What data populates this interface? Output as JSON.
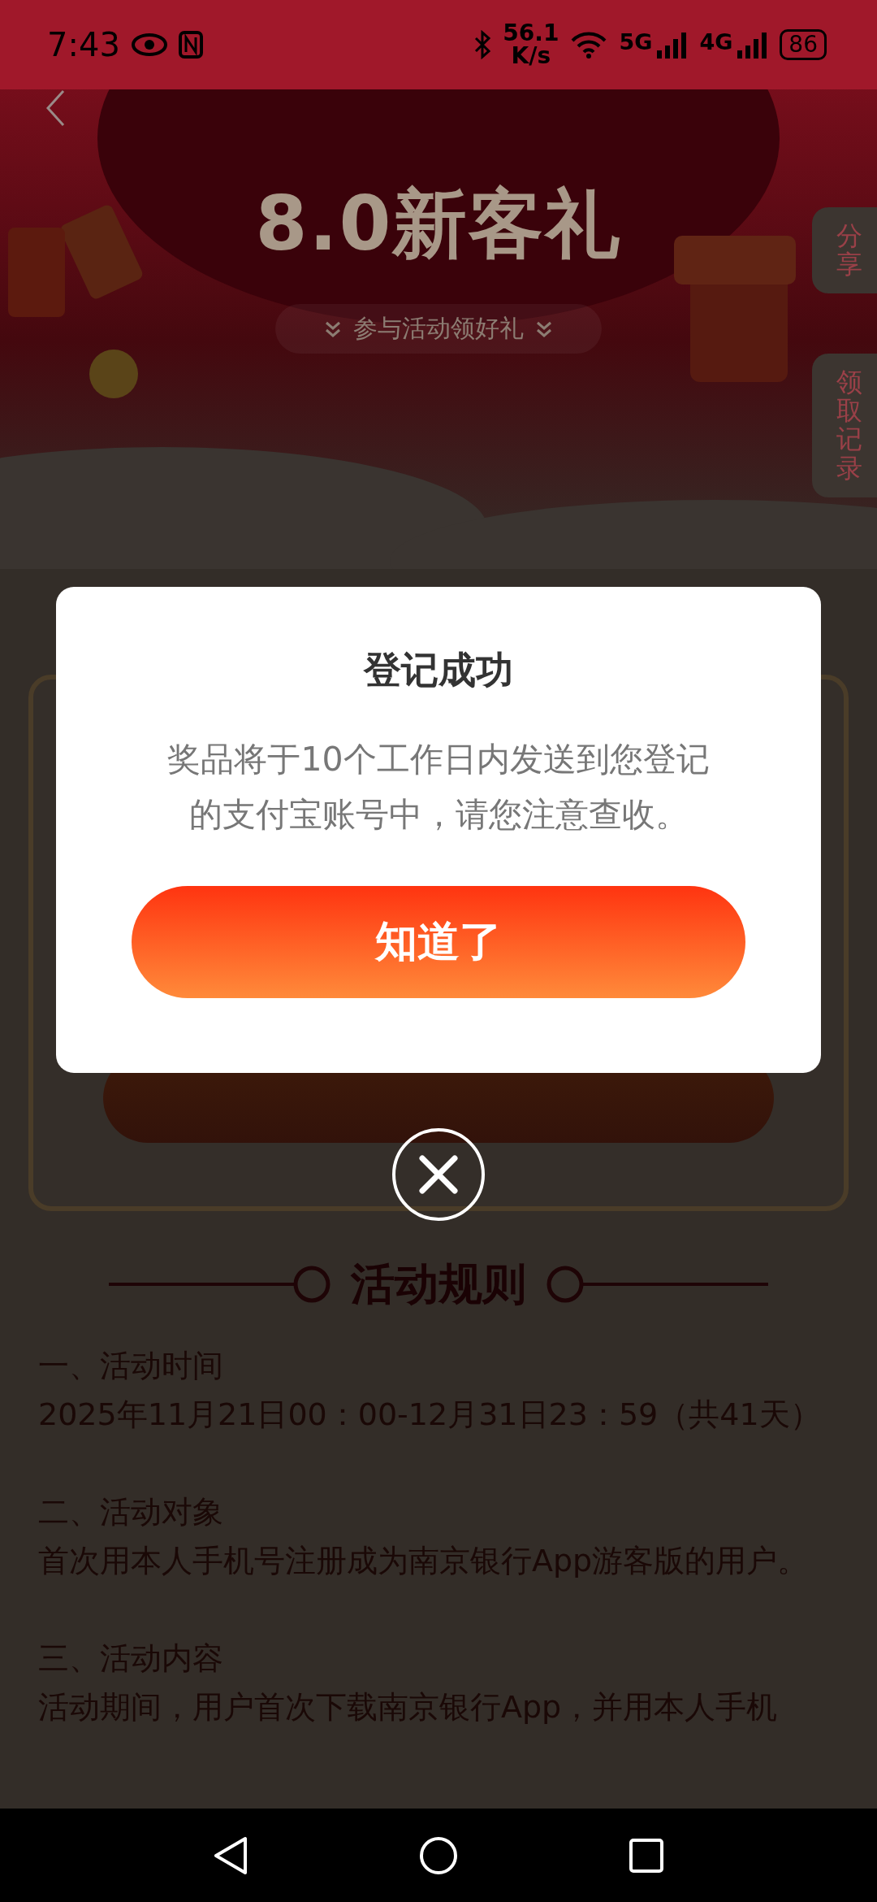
{
  "status_bar": {
    "time": "7:43",
    "net_speed": [
      "56.1",
      "K/s"
    ],
    "signal_labels": [
      "5G",
      "4G"
    ],
    "battery": "86"
  },
  "hero": {
    "title": "8.0新客礼",
    "subtitle": "参与活动领好礼"
  },
  "side_tabs": [
    "分享",
    "领取记录"
  ],
  "rules": {
    "title": "活动规则",
    "items": [
      {
        "heading": "一、活动时间",
        "body": " 2025年11月21日00：00-12月31日23：59（共41天）"
      },
      {
        "heading": "二、活动对象",
        "body": "首次用本人手机号注册成为南京银行App游客版的用户。"
      },
      {
        "heading": "三、活动内容",
        "body": "活动期间，用户首次下载南京银行App，并用本人手机"
      }
    ]
  },
  "dialog": {
    "title": "登记成功",
    "message": "奖品将于10个工作日内发送到您登记的支付宝账号中，请您注意查收。",
    "button": "知道了"
  }
}
